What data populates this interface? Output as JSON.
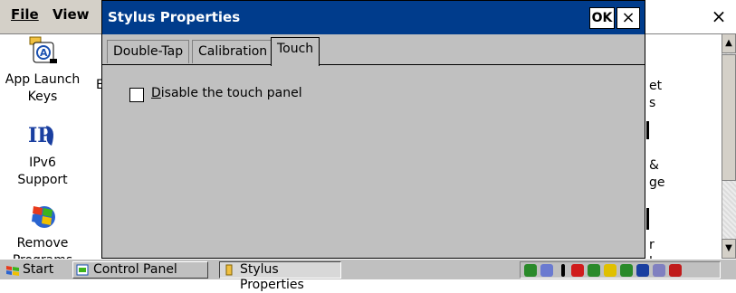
{
  "menubar": {
    "file": "File",
    "view": "View"
  },
  "control_panel": {
    "items": [
      {
        "label_line1": "App Launch",
        "label_line2": "Keys"
      },
      {
        "label_line1": "IPv6",
        "label_line2": "Support"
      },
      {
        "label_line1": "Remove",
        "label_line2": "Programs"
      }
    ],
    "partial_right": [
      {
        "line1": "et",
        "line2": "s"
      },
      {
        "line1": "&",
        "line2": "ge"
      },
      {
        "line1": "r",
        "line2": "l"
      }
    ],
    "partial_left_letter": "E",
    "close_glyph": "×"
  },
  "dialog": {
    "title": "Stylus Properties",
    "ok_label": "OK",
    "close_glyph": "×",
    "tabs": [
      {
        "label": "Double-Tap"
      },
      {
        "label": "Calibration"
      },
      {
        "label": "Touch",
        "active": true
      }
    ],
    "checkbox": {
      "label": "Disable the touch panel",
      "checked": false
    }
  },
  "taskbar": {
    "start_label": "Start",
    "tasks": [
      {
        "label": "Control Panel"
      },
      {
        "label": "Stylus Properties",
        "active": true
      }
    ]
  },
  "colors": {
    "titlebar": "#003c8c",
    "dialog_bg": "#c0c0c0",
    "taskbar_bg": "#c0c0c0"
  }
}
